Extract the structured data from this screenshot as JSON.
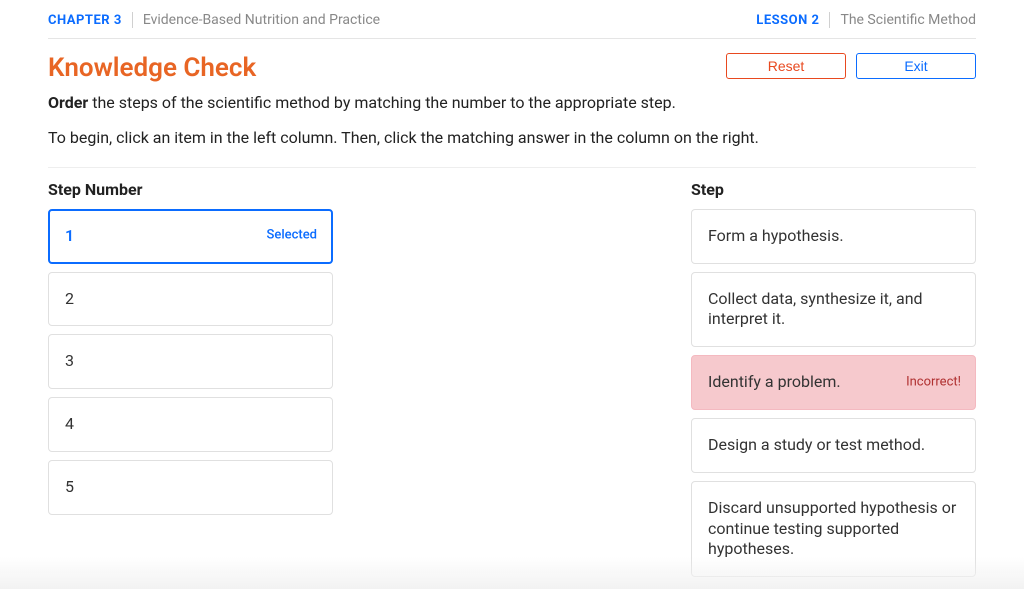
{
  "header": {
    "chapter_label": "CHAPTER 3",
    "chapter_title": "Evidence-Based Nutrition and Practice",
    "lesson_label": "LESSON 2",
    "lesson_title": "The Scientific Method"
  },
  "title": "Knowledge Check",
  "buttons": {
    "reset": "Reset",
    "exit": "Exit"
  },
  "prompt": {
    "bold": "Order",
    "rest": " the steps of the scientific method by matching the number to the appropriate step."
  },
  "instructions": "To begin, click an item in the left column. Then, click the matching answer in the column on the right.",
  "left": {
    "header": "Step Number",
    "items": [
      {
        "label": "1",
        "selected": true,
        "selected_tag": "Selected"
      },
      {
        "label": "2"
      },
      {
        "label": "3"
      },
      {
        "label": "4"
      },
      {
        "label": "5"
      }
    ]
  },
  "right": {
    "header": "Step",
    "items": [
      {
        "label": "Form a hypothesis."
      },
      {
        "label": "Collect data, synthesize it, and interpret it."
      },
      {
        "label": "Identify a problem.",
        "incorrect": true,
        "incorrect_tag": "Incorrect!"
      },
      {
        "label": "Design a study or test method."
      },
      {
        "label": "Discard unsupported hypothesis or continue testing supported hypotheses."
      }
    ]
  }
}
